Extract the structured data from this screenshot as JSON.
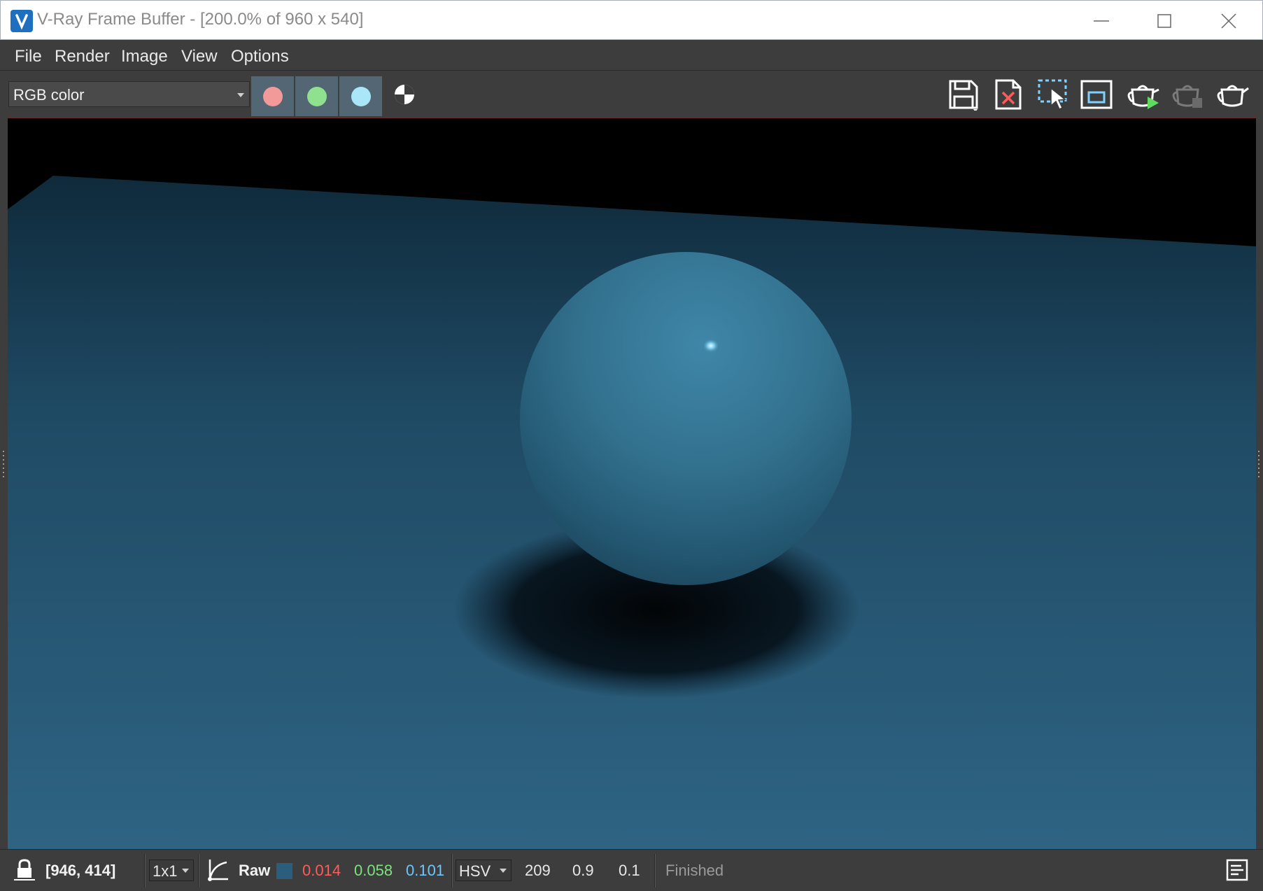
{
  "window": {
    "title": "V-Ray Frame Buffer - [200.0% of 960 x 540]",
    "controls": {
      "minimize_icon": "minimize-icon",
      "maximize_icon": "maximize-icon",
      "close_icon": "close-icon"
    }
  },
  "menu": {
    "items": [
      "File",
      "Render",
      "Image",
      "View",
      "Options"
    ]
  },
  "toolbar": {
    "channel": "RGB color",
    "channel_buttons": [
      {
        "name": "red-channel",
        "color": "#f29a9a"
      },
      {
        "name": "green-channel",
        "color": "#8fe08f"
      },
      {
        "name": "blue-channel",
        "color": "#a8e6f8"
      }
    ],
    "actions": [
      "save-icon",
      "clear-image-icon",
      "region-render-icon",
      "follow-mouse-icon",
      "interactive-render-icon",
      "stop-render-icon",
      "render-icon"
    ]
  },
  "viewport": {
    "scene_colors": {
      "background": "#000000",
      "floor": "#2b5e7d",
      "sphere": "#3a7a9b",
      "highlight": "#cdf4ff"
    }
  },
  "status": {
    "coords": "[946, 414]",
    "sample_size": "1x1",
    "mode": "Raw",
    "swatch_color": "#2b5e7d",
    "r": "0.014",
    "g": "0.058",
    "b": "0.101",
    "color_space": "HSV",
    "h": "209",
    "s": "0.9",
    "v": "0.1",
    "state": "Finished",
    "colors": {
      "r": "#ff5b5b",
      "g": "#7be37b",
      "b": "#6cc6ff"
    }
  }
}
